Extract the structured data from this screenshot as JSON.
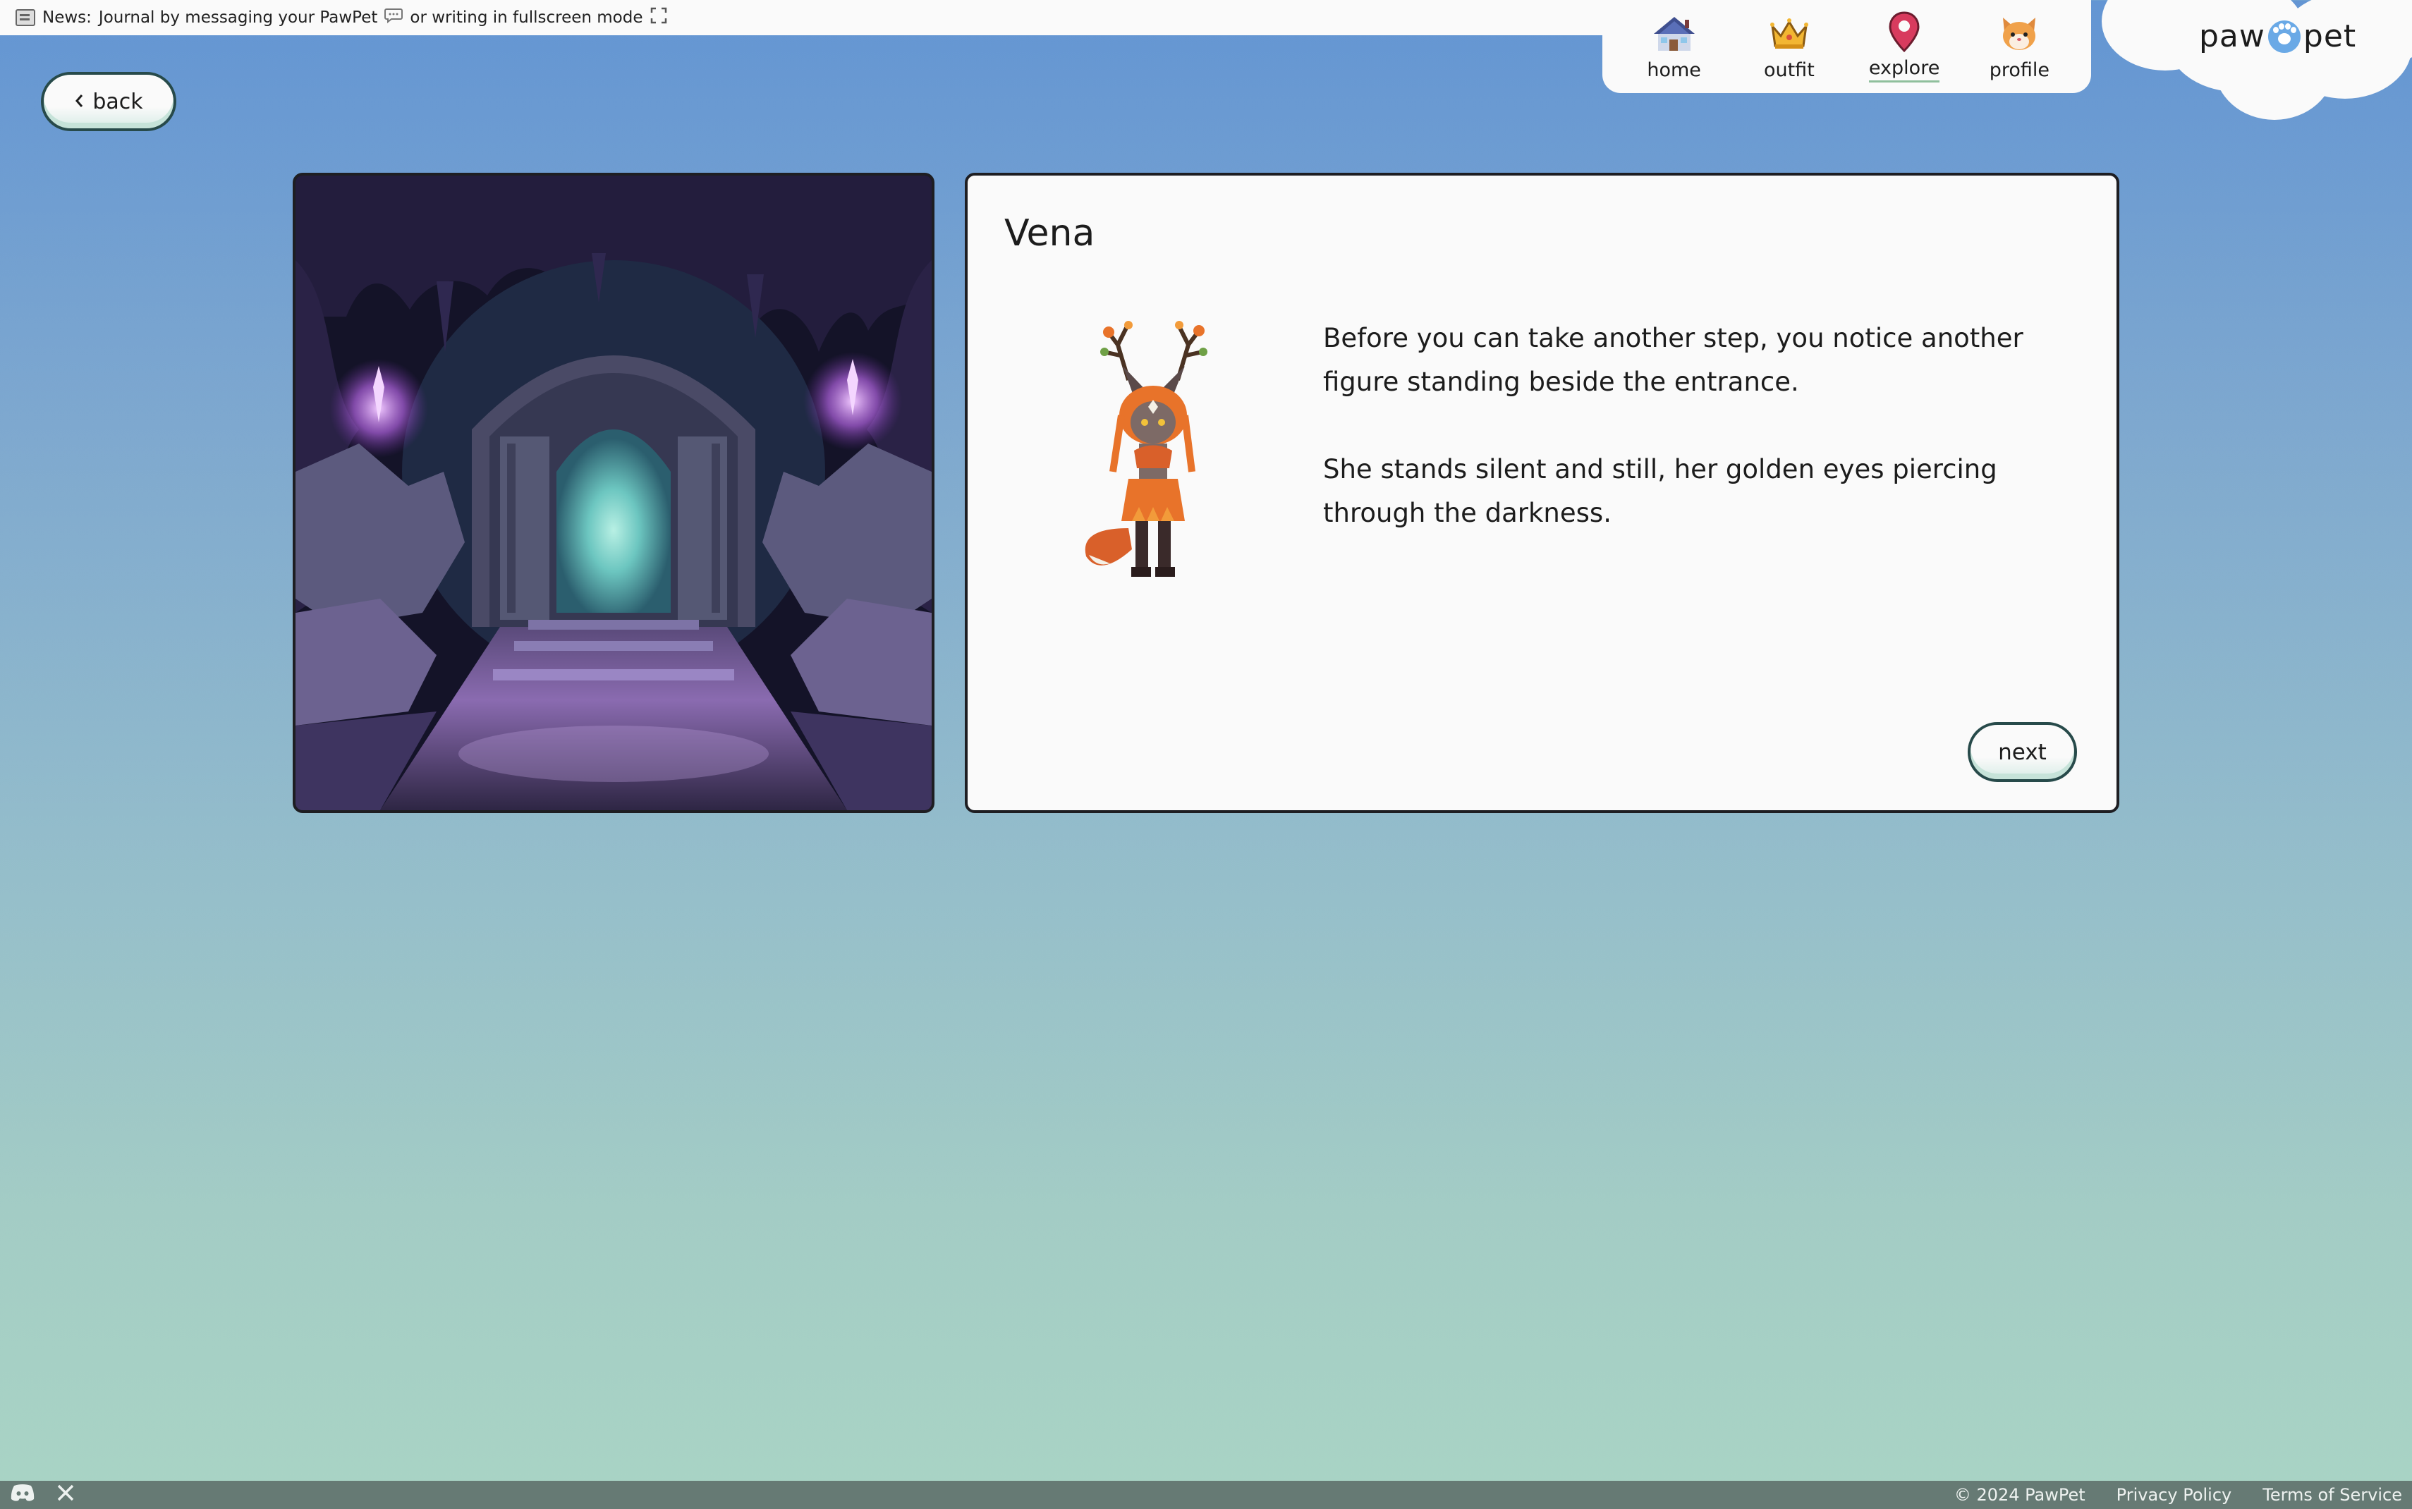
{
  "news": {
    "prefix": "News:",
    "text": "Journal by messaging your PawPet",
    "middle": "or writing in fullscreen mode"
  },
  "nav": {
    "items": [
      {
        "label": "home",
        "icon": "house-icon"
      },
      {
        "label": "outfit",
        "icon": "crown-icon"
      },
      {
        "label": "explore",
        "icon": "map-pin-icon",
        "active": true
      },
      {
        "label": "profile",
        "icon": "cat-face-icon"
      }
    ]
  },
  "logo": {
    "left": "paw",
    "right": "pet"
  },
  "back": {
    "label": "back"
  },
  "dialog": {
    "speaker": "Vena",
    "paragraphs": [
      "Before you can take another step, you notice another figure standing beside the entrance.",
      "She stands silent and still, her golden eyes piercing through the darkness."
    ],
    "next_label": "next"
  },
  "footer": {
    "copyright": "© 2024 PawPet",
    "privacy": "Privacy Policy",
    "terms": "Terms of Service"
  }
}
